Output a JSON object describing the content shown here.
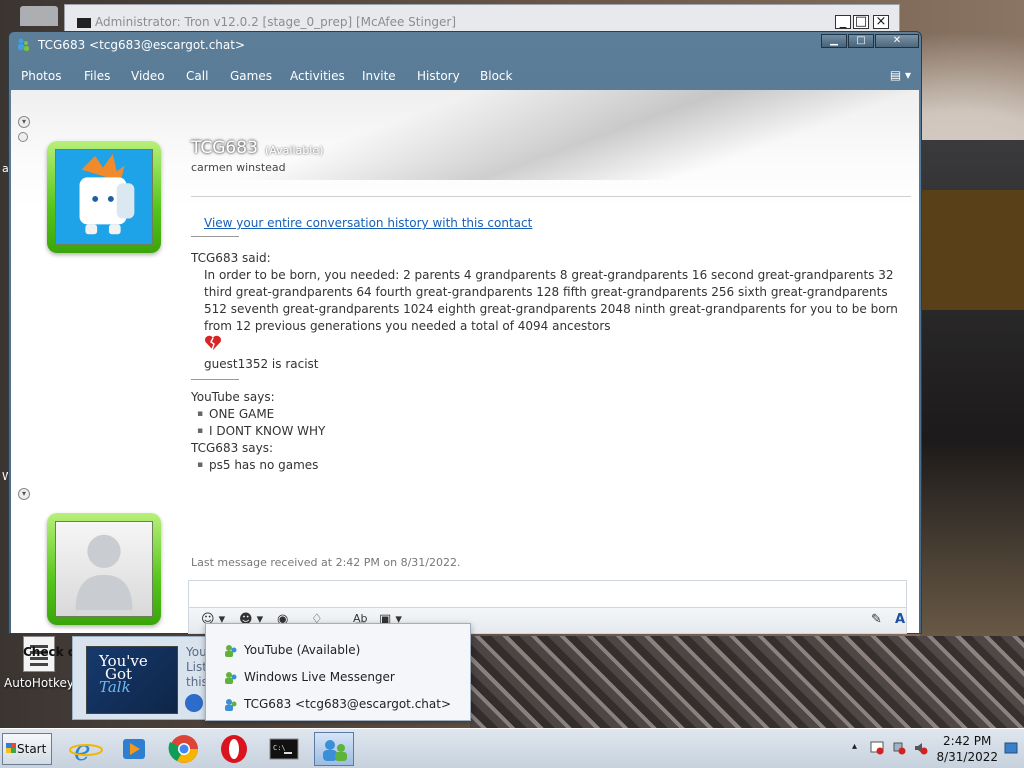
{
  "background_window": {
    "title": "Administrator:  Tron v12.0.2 [stage_0_prep] [McAfee Stinger]"
  },
  "window": {
    "title": "TCG683 <tcg683@escargot.chat>",
    "controls": [
      "_",
      "□",
      "x"
    ]
  },
  "menu": {
    "items": [
      "Photos",
      "Files",
      "Video",
      "Call",
      "Games",
      "Activities",
      "Invite",
      "History",
      "Block"
    ],
    "options_icon": "options-dropdown-icon"
  },
  "contact": {
    "name": "TCG683",
    "status": "(Available)",
    "personal_message": "carmen winstead"
  },
  "history_link": "View your entire conversation history with this contact",
  "conversation": {
    "block1": {
      "sender": "TCG683 said:",
      "message": "In order to be born, you needed: 2 parents 4 grandparents 8 great-grandparents 16 second great-grandparents 32 third great-grandparents 64 fourth great-grandparents 128 fifth great-grandparents 256 sixth great-grandparents 512 seventh great-grandparents 1024 eighth great-grandparents 2048 ninth great-grandparents for you to be born from 12 previous generations you needed a total of 4094 ancestors",
      "emoticon": "broken-heart-icon",
      "message2": "guest1352 is racist"
    },
    "block2": {
      "sender": "YouTube says:",
      "items": [
        "ONE GAME",
        "I DONT KNOW WHY"
      ]
    },
    "block3": {
      "sender": "TCG683 says:",
      "items": [
        "ps5 has no games"
      ]
    }
  },
  "last_message": "Last message received at 2:42 PM on 8/31/2022.",
  "input": {
    "value": "",
    "placeholder": ""
  },
  "ad": {
    "text": "Check out our new forum!"
  },
  "toast": {
    "image_text_1": "You've",
    "image_text_2": "Got",
    "image_text_3": "Talk",
    "side_line1": "You",
    "side_line2": "List",
    "side_line3": "this"
  },
  "desktop": {
    "icon_label": "AutoHotkey",
    "edge_letter_a": "a",
    "edge_letter_w": "W"
  },
  "popup": {
    "items": [
      "YouTube (Available)",
      "Windows Live Messenger",
      "TCG683 <tcg683@escargot.chat>"
    ]
  },
  "taskbar": {
    "start_label": "Start",
    "apps": [
      "internet-explorer-icon",
      "media-player-icon",
      "chrome-icon",
      "opera-icon",
      "command-prompt-icon",
      "messenger-icon"
    ],
    "clock_time": "2:42 PM",
    "clock_date": "8/31/2022"
  },
  "colors": {
    "window_frame": "#5c7e99",
    "avatar_frame": "#56c51b",
    "link": "#1560b8",
    "taskbar": "#d3dce6"
  }
}
